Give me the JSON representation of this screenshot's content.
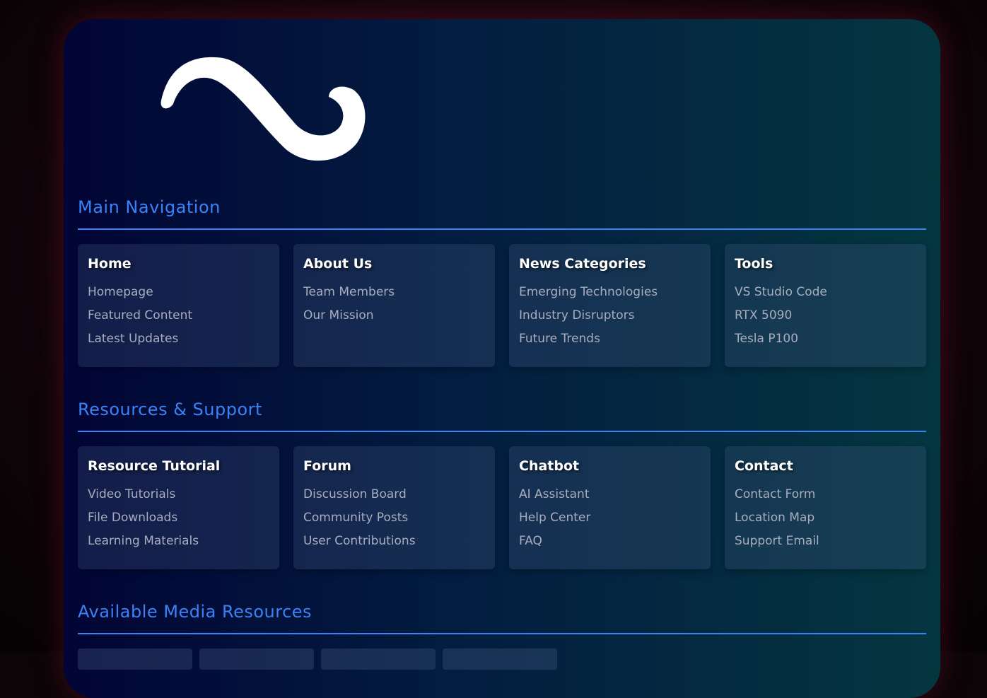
{
  "sections": [
    {
      "title": "Main Navigation",
      "cards": [
        {
          "title": "Home",
          "links": [
            "Homepage",
            "Featured Content",
            "Latest Updates"
          ]
        },
        {
          "title": "About Us",
          "links": [
            "Team Members",
            "Our Mission"
          ]
        },
        {
          "title": "News Categories",
          "links": [
            "Emerging Technologies",
            "Industry Disruptors",
            "Future Trends"
          ]
        },
        {
          "title": "Tools",
          "links": [
            "VS Studio Code",
            "RTX 5090",
            "Tesla P100"
          ]
        }
      ]
    },
    {
      "title": "Resources & Support",
      "cards": [
        {
          "title": "Resource Tutorial",
          "links": [
            "Video Tutorials",
            "File Downloads",
            "Learning Materials"
          ]
        },
        {
          "title": "Forum",
          "links": [
            "Discussion Board",
            "Community Posts",
            "User Contributions"
          ]
        },
        {
          "title": "Chatbot",
          "links": [
            "AI Assistant",
            "Help Center",
            "FAQ"
          ]
        },
        {
          "title": "Contact",
          "links": [
            "Contact Form",
            "Location Map",
            "Support Email"
          ]
        }
      ]
    },
    {
      "title": "Available Media Resources"
    }
  ],
  "colors": {
    "accent": "#3b82f6",
    "card_title": "#ffffff",
    "link": "#a8adbd"
  },
  "icons": {
    "logo": "tilde-logo-icon"
  }
}
